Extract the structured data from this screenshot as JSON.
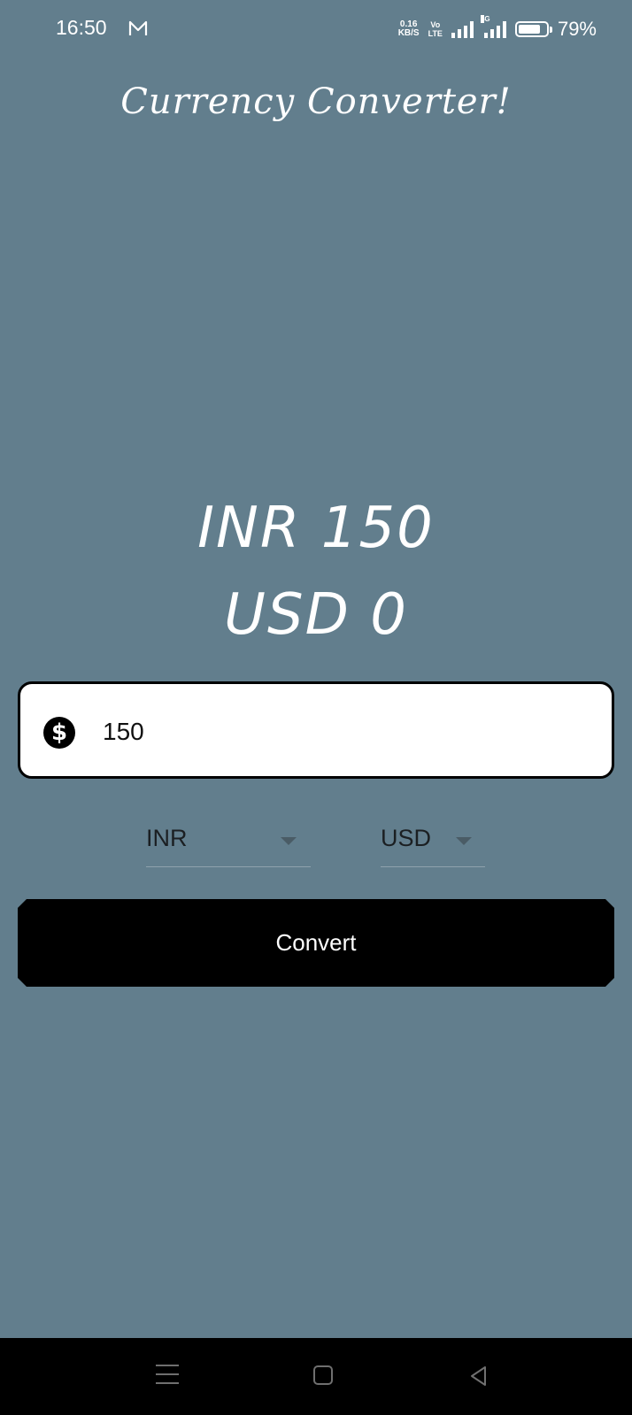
{
  "status_bar": {
    "time": "16:50",
    "net_speed_value": "0.16",
    "net_speed_unit": "KB/S",
    "volte_top": "Vo",
    "volte_bottom": "LTE",
    "network_type": "4G",
    "battery_percent": "79%",
    "battery_level": 0.79
  },
  "app": {
    "title": "Currency Converter!"
  },
  "result": {
    "from_text": "INR 150",
    "to_text": "USD 0"
  },
  "amount_input": {
    "value": "150",
    "icon": "dollar-circle-icon"
  },
  "dropdowns": {
    "from_currency": "INR",
    "to_currency": "USD"
  },
  "convert_button": {
    "label": "Convert"
  },
  "nav_bar": {
    "icons": [
      "menu-icon",
      "home-icon",
      "back-icon"
    ]
  },
  "colors": {
    "background": "#627e8d",
    "button": "#000000",
    "input_background": "#ffffff"
  }
}
